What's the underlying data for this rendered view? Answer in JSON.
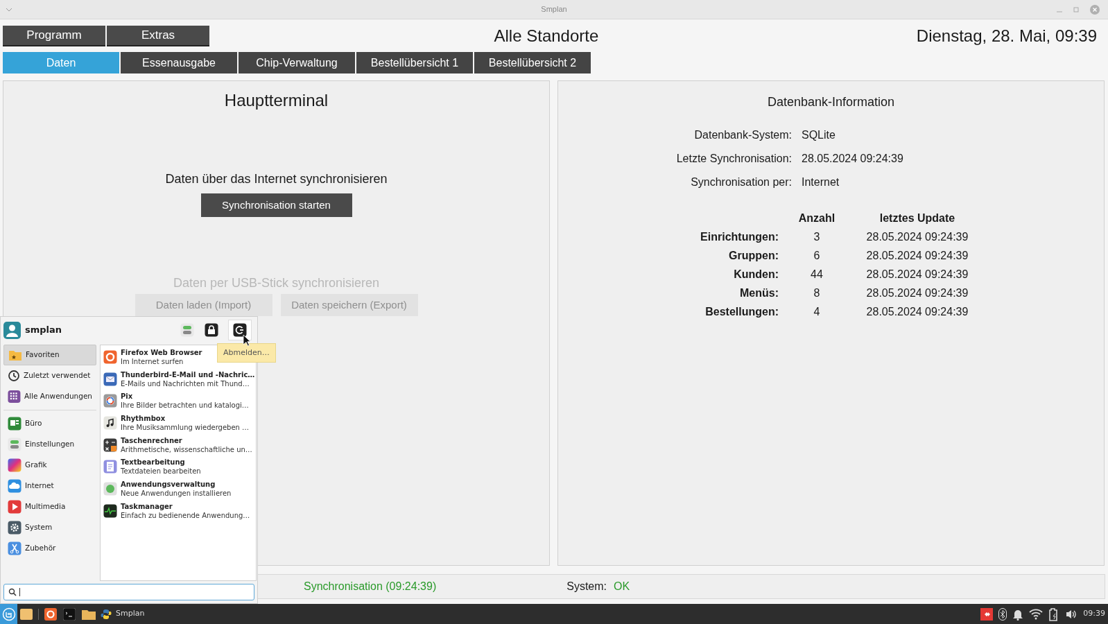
{
  "window": {
    "title": "Smplan"
  },
  "menu_buttons": [
    "Programm",
    "Extras"
  ],
  "header": {
    "title": "Alle Standorte",
    "datetime": "Dienstag, 28. Mai, 09:39"
  },
  "tabs": [
    {
      "label": "Daten",
      "selected": true
    },
    {
      "label": "Essenausgabe",
      "selected": false
    },
    {
      "label": "Chip-Verwaltung",
      "selected": false
    },
    {
      "label": "Bestellübersicht 1",
      "selected": false
    },
    {
      "label": "Bestellübersicht 2",
      "selected": false
    }
  ],
  "left_panel": {
    "title": "Hauptterminal",
    "internet_section": {
      "label": "Daten über das Internet synchronisieren",
      "button": "Synchronisation starten"
    },
    "usb_section": {
      "label": "Daten per USB-Stick synchronisieren",
      "buttons": [
        "Daten laden (Import)",
        "Daten speichern (Export)"
      ],
      "disabled": true
    }
  },
  "right_panel": {
    "title": "Datenbank-Information",
    "info": [
      {
        "label": "Datenbank-System:",
        "value": "SQLite"
      },
      {
        "label": "Letzte Synchronisation:",
        "value": "28.05.2024 09:24:39"
      },
      {
        "label": "Synchronisation per:",
        "value": "Internet"
      }
    ],
    "table": {
      "columns": [
        "Anzahl",
        "letztes Update"
      ],
      "rows": [
        {
          "label": "Einrichtungen:",
          "count": "3",
          "updated": "28.05.2024 09:24:39"
        },
        {
          "label": "Gruppen:",
          "count": "6",
          "updated": "28.05.2024 09:24:39"
        },
        {
          "label": "Kunden:",
          "count": "44",
          "updated": "28.05.2024 09:24:39"
        },
        {
          "label": "Menüs:",
          "count": "8",
          "updated": "28.05.2024 09:24:39"
        },
        {
          "label": "Bestellungen:",
          "count": "4",
          "updated": "28.05.2024 09:24:39"
        }
      ]
    }
  },
  "status_bar": {
    "sync": "Synchronisation (09:24:39)",
    "system_label": "System:",
    "system_value": "OK"
  },
  "start_menu": {
    "user": "smplan",
    "tooltip": "Abmelden…",
    "categories": [
      {
        "label": "Favoriten",
        "selected": true
      },
      {
        "label": "Zuletzt verwendet",
        "selected": false
      },
      {
        "label": "Alle Anwendungen",
        "selected": false
      },
      {
        "label": "Büro",
        "selected": false
      },
      {
        "label": "Einstellungen",
        "selected": false
      },
      {
        "label": "Grafik",
        "selected": false
      },
      {
        "label": "Internet",
        "selected": false
      },
      {
        "label": "Multimedia",
        "selected": false
      },
      {
        "label": "System",
        "selected": false
      },
      {
        "label": "Zubehör",
        "selected": false
      }
    ],
    "apps": [
      {
        "name": "Firefox Web Browser",
        "description": "Im Internet surfen"
      },
      {
        "name": "Thunderbird-E-Mail und -Nachric…",
        "description": "E-Mails und Nachrichten mit Thund…"
      },
      {
        "name": "Pix",
        "description": "Ihre Bilder betrachten und katalogi…"
      },
      {
        "name": "Rhythmbox",
        "description": "Ihre Musiksammlung wiedergeben …"
      },
      {
        "name": "Taschenrechner",
        "description": "Arithmetische, wissenschaftliche un…"
      },
      {
        "name": "Textbearbeitung",
        "description": "Textdateien bearbeiten"
      },
      {
        "name": "Anwendungsverwaltung",
        "description": "Neue Anwendungen installieren"
      },
      {
        "name": "Taskmanager",
        "description": "Einfach zu bedienende Anwendung…"
      }
    ]
  },
  "taskbar": {
    "window_label": "Smplan",
    "clock": "09:39"
  }
}
